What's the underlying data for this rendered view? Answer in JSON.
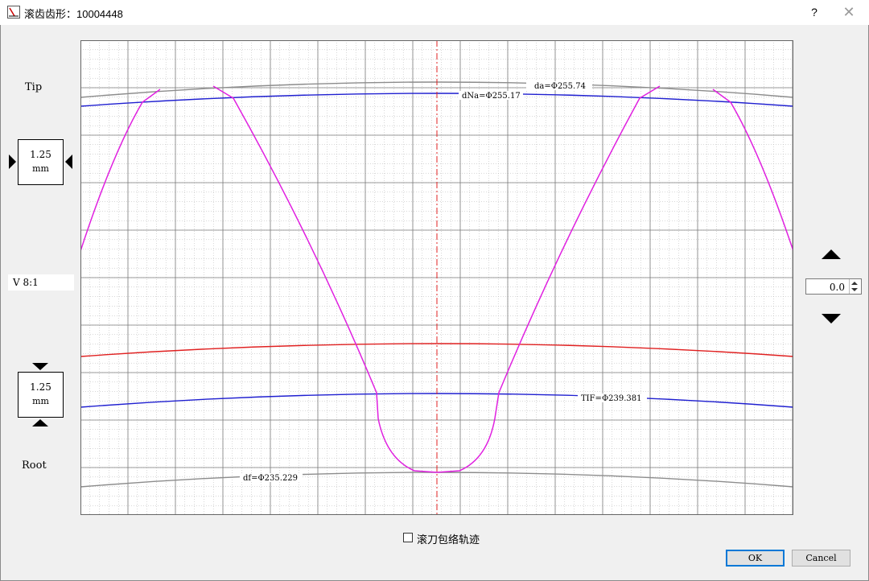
{
  "window": {
    "title": "滚齿齿形：10004448",
    "help_label": "?",
    "close_label": "✕",
    "icon": "gear-profile-icon"
  },
  "left_panel": {
    "tip_label": "Tip",
    "root_label": "Root",
    "top_scale": {
      "value": "1.25",
      "unit": "mm"
    },
    "bottom_scale": {
      "value": "1.25",
      "unit": "mm"
    },
    "ratio_label": "V 8:1"
  },
  "right_panel": {
    "offset_value": "0.0"
  },
  "plot": {
    "annotations": {
      "da": "da=Φ255.74",
      "dNa": "dNa=Φ255.17",
      "TIF": "TIF=Φ239.381",
      "df": "df=Φ235.229"
    },
    "colors": {
      "grid_major": "#7a7a7a",
      "grid_minor": "#b0b0b0",
      "tip_circle": "#8c8c8c",
      "dNa_circle": "#1f1fd0",
      "red_circle": "#e02020",
      "TIF_circle": "#1f1fd0",
      "root_circle": "#8c8c8c",
      "profile": "#e020e0",
      "center_line": "#e02020"
    }
  },
  "footer": {
    "checkbox_label": "滚刀包络轨迹",
    "checkbox_checked": false,
    "ok_label": "OK",
    "cancel_label": "Cancel"
  }
}
